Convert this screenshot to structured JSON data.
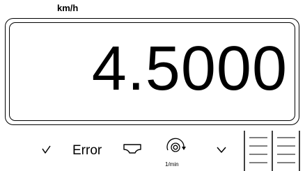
{
  "display": {
    "unit": "km/h",
    "value": "4.5000"
  },
  "softkeys": {
    "error_label": "Error",
    "rpm_unit": "1/min"
  },
  "icons": [
    "checkmark-icon",
    "hopper-icon",
    "rotation-speed-icon",
    "chevron-right-icon",
    "bar-indicator-icon"
  ]
}
